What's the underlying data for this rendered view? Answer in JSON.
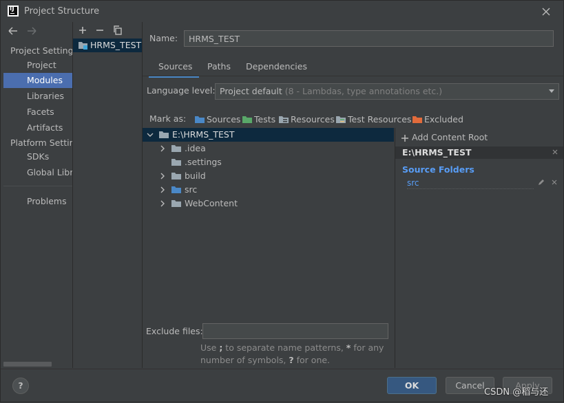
{
  "window": {
    "title": "Project Structure"
  },
  "nav": {
    "project_settings_heading": "Project Settings",
    "platform_settings_heading": "Platform Settings",
    "items": [
      {
        "label": "Project"
      },
      {
        "label": "Modules"
      },
      {
        "label": "Libraries"
      },
      {
        "label": "Facets"
      },
      {
        "label": "Artifacts"
      },
      {
        "label": "SDKs"
      },
      {
        "label": "Global Libraries"
      },
      {
        "label": "Problems"
      }
    ]
  },
  "modules": {
    "items": [
      {
        "label": "HRMS_TEST"
      }
    ]
  },
  "name_field": {
    "label": "Name:",
    "value": "HRMS_TEST"
  },
  "tabs": [
    {
      "label": "Sources"
    },
    {
      "label": "Paths"
    },
    {
      "label": "Dependencies"
    }
  ],
  "language_level": {
    "label": "Language level:",
    "value": "Project default",
    "hint": "(8 - Lambdas, type annotations etc.)"
  },
  "mark_as": {
    "label": "Mark as:",
    "items": [
      {
        "label": "Sources",
        "color": "#4a88c7"
      },
      {
        "label": "Tests",
        "color": "#59a869"
      },
      {
        "label": "Resources",
        "color": "#9aa7b0"
      },
      {
        "label": "Test Resources",
        "color": "#9aa7b0"
      },
      {
        "label": "Excluded",
        "color": "#e26b3b"
      }
    ]
  },
  "tree": {
    "root": "E:\\HRMS_TEST",
    "children": [
      {
        "label": ".idea"
      },
      {
        "label": ".settings"
      },
      {
        "label": "build"
      },
      {
        "label": "src"
      },
      {
        "label": "WebContent"
      }
    ]
  },
  "content_root": {
    "add_label": "Add Content Root",
    "path": "E:\\HRMS_TEST",
    "source_folders_title": "Source Folders",
    "source_folders": [
      "src"
    ]
  },
  "exclude_files": {
    "label": "Exclude files:",
    "value": "",
    "help_prefix": "Use ",
    "help_sep": ";",
    "help_mid": " to separate name patterns, ",
    "help_star": "*",
    "help_mid2": " for any number of symbols, ",
    "help_q": "?",
    "help_suffix": " for one."
  },
  "buttons": {
    "help": "?",
    "ok": "OK",
    "cancel": "Cancel",
    "apply": "Apply"
  },
  "watermark": "CSDN @稻与还"
}
